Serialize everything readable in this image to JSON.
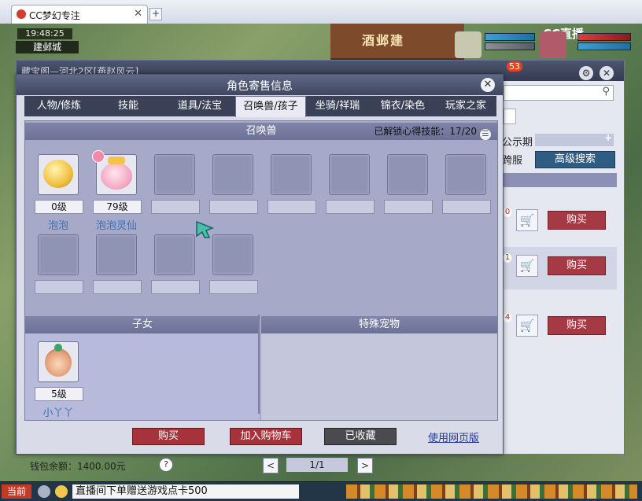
{
  "browser": {
    "tab_title": "CC梦幻专注",
    "tab_close": "✕",
    "new_tab": "+"
  },
  "game": {
    "clock": "19:48:25",
    "location": "建邺城",
    "roof_sign": "酒邺建",
    "cc_logo": "CC直播",
    "mail_badge": "53"
  },
  "back_window": {
    "title": "藏宝阁—河北2区[燕赵风云]",
    "label_show_period": "公示期",
    "label_cross_server": "跨服",
    "advanced_search": "高级搜索",
    "rows": [
      {
        "badge": "0",
        "buy": "购买"
      },
      {
        "badge": "1",
        "buy": "购买"
      },
      {
        "badge": "4",
        "buy": "购买"
      }
    ],
    "wallet": "钱包余额：1400.00元",
    "help": "?",
    "prev": "<",
    "page": "1/1",
    "next": ">"
  },
  "dialog": {
    "title": "角色寄售信息",
    "close": "✕",
    "tabs": [
      "人物/修炼",
      "技能",
      "道具/法宝",
      "召唤兽/孩子",
      "坐骑/祥瑞",
      "锦衣/染色",
      "玩家之家"
    ],
    "active_tab": 3,
    "summon_header": "召唤兽",
    "unlock_label": "已解锁心得技能：",
    "unlock_value": "17/20",
    "pets": [
      {
        "level": "0级",
        "name": "泡泡"
      },
      {
        "level": "79级",
        "name": "泡泡灵仙"
      }
    ],
    "children_header": "子女",
    "special_header": "特殊宠物",
    "children": [
      {
        "level": "5级",
        "name": "小丫丫"
      }
    ],
    "buttons": {
      "buy": "购买",
      "add_cart": "加入购物车",
      "favorited": "已收藏",
      "web": "使用网页版"
    }
  },
  "taskbar": {
    "start": "当前",
    "marquee": "直播间下单赠送游戏点卡500"
  }
}
